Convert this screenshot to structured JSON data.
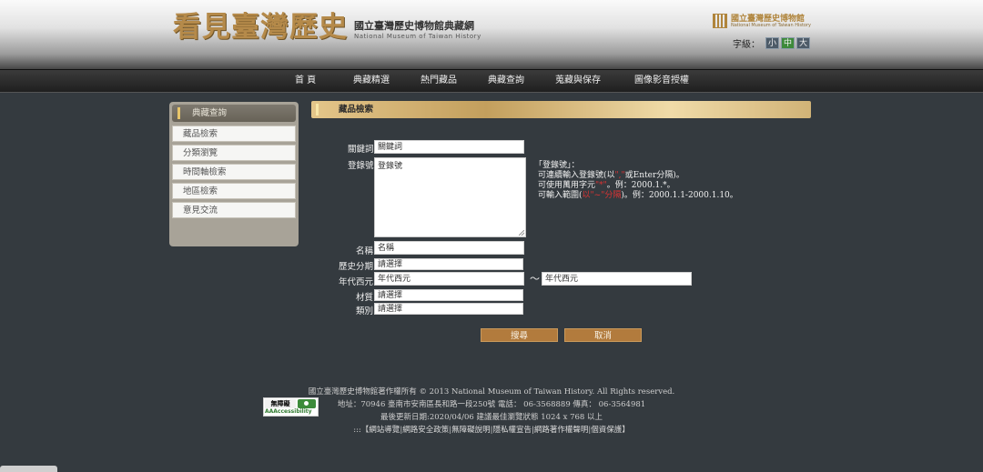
{
  "header": {
    "logo_text": "看見臺灣歷史",
    "site_title": "國立臺灣歷史博物館典藏網",
    "site_subtitle": "National Museum of Taiwan History",
    "museum_name": "國立臺灣歷史博物館",
    "museum_name_en": "National Museum of Taiwan History",
    "font_size_label": "字級：",
    "font_sizes": [
      "小",
      "中",
      "大"
    ],
    "active_font_size": "中"
  },
  "nav": {
    "items": [
      "首 頁",
      "典藏精選",
      "熱門藏品",
      "典藏查詢",
      "蒐藏與保存",
      "圖像影音授權"
    ]
  },
  "sidebar": {
    "title": "典藏查詢",
    "items": [
      "藏品檢索",
      "分類瀏覽",
      "時間軸檢索",
      "地區檢索",
      "意見交流"
    ]
  },
  "section": {
    "title": "藏品檢索"
  },
  "form": {
    "keyword_label": "關鍵詞",
    "keyword_value": "關鍵詞",
    "regno_label": "登錄號",
    "regno_value": "登錄號",
    "name_label": "名稱",
    "name_value": "名稱",
    "period_label": "歷史分期",
    "period_value": "請選擇",
    "year_label": "年代西元",
    "year_from_value": "年代西元",
    "year_to_value": "年代西元",
    "year_sep": "～",
    "material_label": "材質",
    "material_value": "請選擇",
    "category_label": "類別",
    "category_value": "請選擇",
    "search_button": "搜尋",
    "cancel_button": "取消"
  },
  "hints": {
    "title": "「登錄號」：",
    "line1_pre": "可連續輸入登錄號(以",
    "line1_red": "\",\"",
    "line1_post": "或Enter分隔)。",
    "line2_pre": "可使用萬用字元",
    "line2_red": "\"*\"",
    "line2_post": "。例：2000.1.*。",
    "line3_pre": "可輸入範圍(",
    "line3_red": "以\"~\"分隔",
    "line3_post": ")。例：2000.1.1-2000.1.10。"
  },
  "footer": {
    "badge_top": "無障礙",
    "badge_bottom": "AAAccessibility",
    "copyright": "國立臺灣歷史博物館著作權所有 © 2013 National Museum of Taiwan History. All Rights reserved.",
    "address": "地址：70946 臺南市安南區長和路一段250號 電話： 06-3568889 傳真： 06-3564981",
    "updated": "最後更新日期:2020/04/06  建議最佳瀏覽狀態 1024 x 768 以上",
    "links_prefix": ":::【",
    "links": [
      "網站導覽",
      "網路安全政策",
      "無障礙說明",
      "隱私權宣告",
      "網路著作權聲明",
      "個資保護"
    ],
    "links_suffix": "】"
  }
}
